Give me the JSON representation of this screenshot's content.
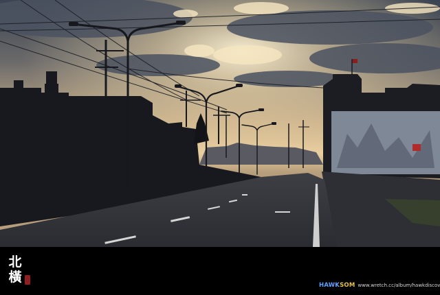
{
  "caption": {
    "line1": "北",
    "line2": "橫"
  },
  "credit": {
    "brand_part1": "HAWK",
    "brand_part2": "SOM",
    "url": "www.wretch.cc/album/hawkdiscover"
  },
  "colors": {
    "sky_top": "#3d4656",
    "sky_glow": "#f3dfb6",
    "seal": "#8f1d22",
    "brand_blue": "#5aa2ff",
    "brand_gold": "#e8c43c"
  }
}
